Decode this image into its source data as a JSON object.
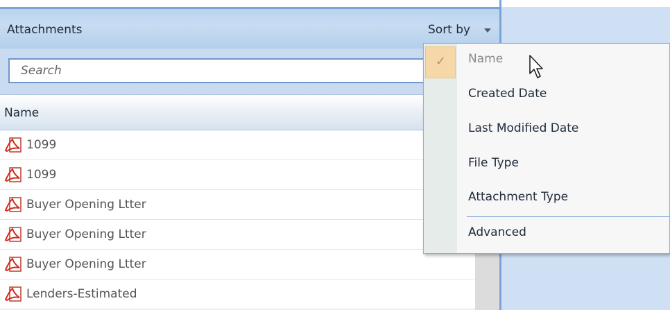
{
  "panel": {
    "title": "Attachments",
    "sort_label": "Sort by",
    "search": {
      "placeholder": "Search",
      "value": ""
    },
    "column_header": "Name",
    "files": [
      {
        "name": "1099",
        "icon": "pdf-icon"
      },
      {
        "name": "1099",
        "icon": "pdf-icon"
      },
      {
        "name": "Buyer Opening Ltter",
        "icon": "pdf-icon"
      },
      {
        "name": "Buyer Opening Ltter",
        "icon": "pdf-icon"
      },
      {
        "name": "Buyer Opening Ltter",
        "icon": "pdf-icon"
      },
      {
        "name": "Lenders-Estimated",
        "icon": "pdf-icon"
      }
    ]
  },
  "sort_menu": {
    "items": [
      {
        "label": "Name",
        "checked": true,
        "disabled": true
      },
      {
        "label": "Created Date"
      },
      {
        "label": "Last Modified Date"
      },
      {
        "label": "File Type"
      },
      {
        "label": "Attachment Type"
      },
      {
        "label": "Advanced"
      }
    ],
    "check_icon": "checkmark-icon"
  },
  "colors": {
    "header_blue": "#b8d4f0",
    "accent_border": "#7aa3d6",
    "checked_highlight": "#f6d7a8"
  }
}
